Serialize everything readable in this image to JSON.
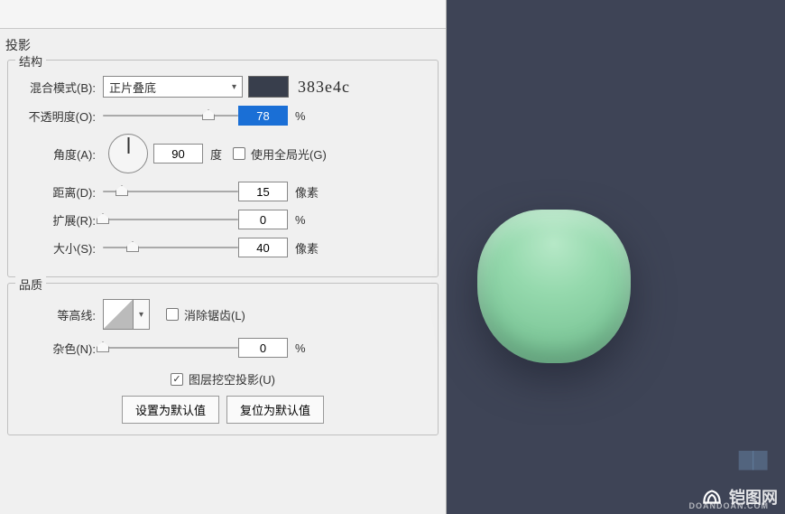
{
  "panel_title": "投影",
  "structure": {
    "legend": "结构",
    "blend_mode_label": "混合模式(B):",
    "blend_mode_value": "正片叠底",
    "color_hex": "383e4c",
    "opacity_label": "不透明度(O):",
    "opacity_value": "78",
    "opacity_unit": "%",
    "angle_label": "角度(A):",
    "angle_value": "90",
    "angle_unit": "度",
    "global_light_label": "使用全局光(G)",
    "global_light_checked": false,
    "distance_label": "距离(D):",
    "distance_value": "15",
    "distance_unit": "像素",
    "spread_label": "扩展(R):",
    "spread_value": "0",
    "spread_unit": "%",
    "size_label": "大小(S):",
    "size_value": "40",
    "size_unit": "像素"
  },
  "quality": {
    "legend": "品质",
    "contour_label": "等高线:",
    "antialias_label": "消除锯齿(L)",
    "antialias_checked": false,
    "noise_label": "杂色(N):",
    "noise_value": "0",
    "noise_unit": "%"
  },
  "knockout": {
    "label": "图层挖空投影(U)",
    "checked": true
  },
  "buttons": {
    "set_default": "设置为默认值",
    "reset_default": "复位为默认值"
  },
  "watermark": {
    "text": "铠图网",
    "url": "DOANDOAN.COM"
  }
}
